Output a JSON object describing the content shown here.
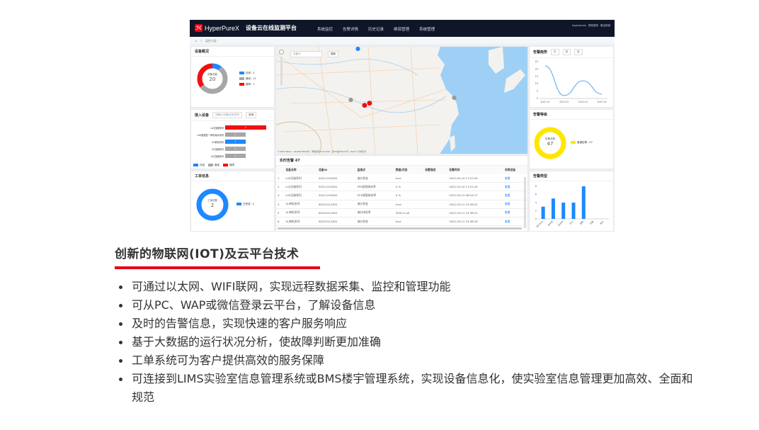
{
  "app": {
    "brand": "HyperPureX",
    "title": "设备云在线监测平台",
    "nav": [
      "系统监控",
      "告警详情",
      "历史记录",
      "维保管理",
      "系统管理"
    ],
    "user": [
      "hyperpurex",
      "修改密码",
      "退出系统"
    ],
    "breadcrumb": "监控大屏"
  },
  "overview": {
    "title": "设备概况",
    "center_label": "设备总数",
    "total": "20",
    "legend": [
      "在线 : 2",
      "离线 : 11",
      "故障 : 7"
    ],
    "values": [
      2,
      11,
      7
    ],
    "colors": [
      "#1e88ff",
      "#a6a6a6",
      "#f01010"
    ]
  },
  "devices": {
    "title": "接入设备",
    "search_placeholder": "设备ID/设备名称/型号",
    "query_label": "查询",
    "rows": [
      {
        "name": "LUS压缩系列",
        "value": "2",
        "color": "#f01010",
        "frac": 1
      },
      {
        "name": "LUS智能型一体化纯水系列",
        "value": "1",
        "color": "#a6a6a6",
        "frac": 0.5
      },
      {
        "name": "XL单机系列",
        "value": "1",
        "color": "#1e88ff",
        "frac": 0.5
      },
      {
        "name": "XL压缩系列",
        "value": "1",
        "color": "#a6a6a6",
        "frac": 0.5
      },
      {
        "name": "UCI压缩系列",
        "value": "1",
        "color": "#a6a6a6",
        "frac": 0.5
      }
    ],
    "legend": [
      "在线",
      "离线",
      "故障"
    ]
  },
  "workorder": {
    "title": "工单信息",
    "center_label": "工单总数",
    "total": "2",
    "legend": "已完成 : 2"
  },
  "map": {
    "search_placeholder": "设备ID",
    "search_label": "搜索",
    "copyright": "© 2022 Baidu - GS(2021)6026号 - 甲测资字11111342 - 京ICP证030173号 - Data © 长地万方"
  },
  "alarms": {
    "title": "实时告警 47",
    "columns": [
      "",
      "设备名称",
      "设备ID",
      "监测点",
      "数据/状态",
      "告警描述",
      "告警时间",
      "关联设备"
    ],
    "rows": [
      [
        "1",
        "LUS压缩系列",
        "5021122X001",
        "液分状态",
        "true",
        "",
        "2022-05-24 17:22:55",
        "查看"
      ],
      [
        "2",
        "LUS压缩系列",
        "5021122X001",
        "PFR权限纳米率",
        "0 %",
        "",
        "2022-05-24 17:22:45",
        "查看"
      ],
      [
        "3",
        "LUS压缩系列",
        "5021122X001",
        "PCR权限纳米率",
        "0 %",
        "",
        "2022-05-13 08:54:17",
        "查看"
      ],
      [
        "4",
        "XL单机系列",
        "8022011X001",
        "液分状态",
        "true",
        "",
        "2022-03-11 15:36:31",
        "查看"
      ],
      [
        "5",
        "XL单机系列",
        "8022011X001",
        "液分电导率",
        "3000.2 µS",
        "",
        "2022-03-11 15:36:21",
        "查看"
      ],
      [
        "6",
        "XL单机系列",
        "8022011X001",
        "液分状态",
        "true",
        "",
        "2022-03-11 15:36:16",
        "查看"
      ]
    ]
  },
  "trend": {
    "title": "告警趋势",
    "tabs": [
      "年",
      "月",
      "日"
    ]
  },
  "level": {
    "title": "告警等级",
    "center_label": "告警总数",
    "total": "47",
    "legend": "普通告警 : 47",
    "color": "#ffe600"
  },
  "types": {
    "title": "告警类型"
  },
  "chart_data": [
    {
      "type": "line",
      "title": "告警趋势",
      "x": [
        "2022-01",
        "2022-02",
        "2022-03",
        "2022-04"
      ],
      "values": [
        22,
        2,
        12,
        3
      ],
      "yticks": [
        "0",
        "5",
        "10",
        "15",
        "20",
        "25"
      ],
      "ylim": [
        0,
        25
      ]
    },
    {
      "type": "bar",
      "title": "告警类型",
      "categories": [
        "液分状态",
        "电导率",
        "纳米率",
        "压力",
        "温度",
        "流量",
        "液位"
      ],
      "values": [
        3,
        5,
        4,
        4,
        8,
        0,
        0
      ],
      "yticks": [
        "0",
        "2",
        "4",
        "6",
        "8"
      ],
      "ylim": [
        0,
        8
      ]
    }
  ],
  "doc": {
    "heading": "创新的物联网(IOT)及云平台技术",
    "bullets": [
      "可通过以太网、WIFI联网，实现远程数据采集、监控和管理功能",
      "可从PC、WAP或微信登录云平台，了解设备信息",
      "及时的告警信息，实现快速的客户服务响应",
      "基于大数据的运行状况分析，使故障判断更加准确",
      "工单系统可为客户提供高效的服务保障",
      "可连接到LIMS实验室信息管理系统或BMS楼宇管理系统，实现设备信息化，使实验室信息管理更加高效、全面和规范"
    ]
  }
}
